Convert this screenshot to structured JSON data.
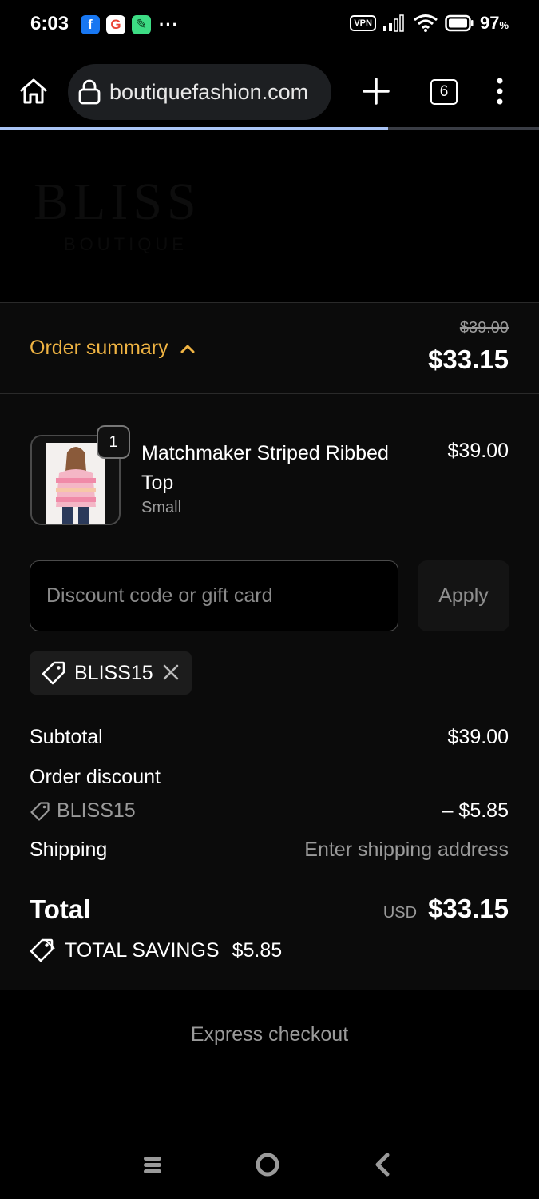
{
  "status_bar": {
    "time": "6:03",
    "app_icons": [
      "facebook-icon",
      "google-icon",
      "tool-app-icon"
    ],
    "more": "···",
    "vpn": "VPN",
    "battery_pct": "97",
    "battery_unit": "%"
  },
  "browser": {
    "url": "boutiquefashion.com",
    "tab_count": "6",
    "load_progress": 0.72
  },
  "hero": {
    "logo": "BLISS",
    "subtitle": "BOUTIQUE"
  },
  "summary": {
    "toggle_label": "Order summary",
    "original_price": "$39.00",
    "total_price": "$33.15",
    "accent_color": "#f0b443"
  },
  "product": {
    "quantity": "1",
    "name": "Matchmaker Striped Ribbed Top",
    "variant": "Small",
    "price": "$39.00"
  },
  "discount": {
    "placeholder": "Discount code or gift card",
    "value": "",
    "apply_label": "Apply",
    "applied_code": "BLISS15"
  },
  "totals": {
    "subtotal_label": "Subtotal",
    "subtotal_value": "$39.00",
    "order_discount_label": "Order discount",
    "discount_code": "BLISS15",
    "discount_value": "– $5.85",
    "shipping_label": "Shipping",
    "shipping_value": "Enter shipping address",
    "total_label": "Total",
    "currency": "USD",
    "total_value": "$33.15",
    "savings_label": "TOTAL SAVINGS",
    "savings_value": "$5.85"
  },
  "express_checkout": "Express checkout"
}
